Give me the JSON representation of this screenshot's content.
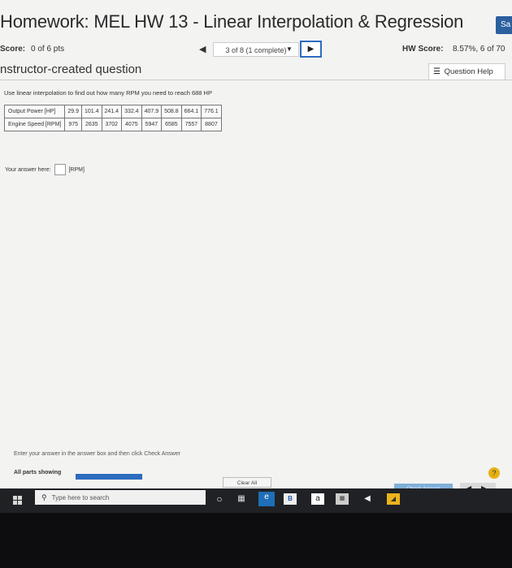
{
  "page": {
    "title": "Homework: MEL HW 13 - Linear Interpolation & Regression",
    "save_label": "Sa"
  },
  "score_row": {
    "score_label": "Score:",
    "score_value": "0 of 6 pts",
    "question_selector": "3 of 8 (1 complete)",
    "hw_score_label": "HW Score:",
    "hw_score_value": "8.57%, 6 of 70"
  },
  "question": {
    "type_label": "nstructor-created question",
    "help_label": "Question Help",
    "instruction": "Use linear interpolation to find out how many RPM you need to reach 688 HP",
    "table": {
      "rows": [
        {
          "label": "Output Power [HP]",
          "values": [
            "29.9",
            "101.4",
            "241.4",
            "332.4",
            "407.9",
            "508.8",
            "664.1",
            "776.1"
          ]
        },
        {
          "label": "Engine Speed [RPM]",
          "values": [
            "975",
            "2635",
            "3702",
            "4075",
            "5947",
            "6585",
            "7557",
            "8807"
          ]
        }
      ]
    },
    "answer_label": "Your answer here:",
    "answer_unit": "[RPM]"
  },
  "footer": {
    "enter_text": "Enter your answer in the answer box and then click Check Answer",
    "parts_label": "All parts showing",
    "progress_fraction": 1.0,
    "clear_all_label": "Clear All",
    "check_answer_label": "Check Answer",
    "help_glyph": "?"
  },
  "taskbar": {
    "search_placeholder": "Type here to search",
    "icons": [
      "windows-start-icon",
      "cortana-icon",
      "task-view-icon",
      "edge-icon",
      "store-icon",
      "amazon-icon",
      "calendar-icon",
      "sketch-icon",
      "yellow-app-icon"
    ]
  },
  "colors": {
    "accent_blue": "#2d6cbf",
    "check_answer_bg": "#7fb0d9",
    "help_yellow": "#e7b114",
    "taskbar_bg": "#1f2125"
  }
}
